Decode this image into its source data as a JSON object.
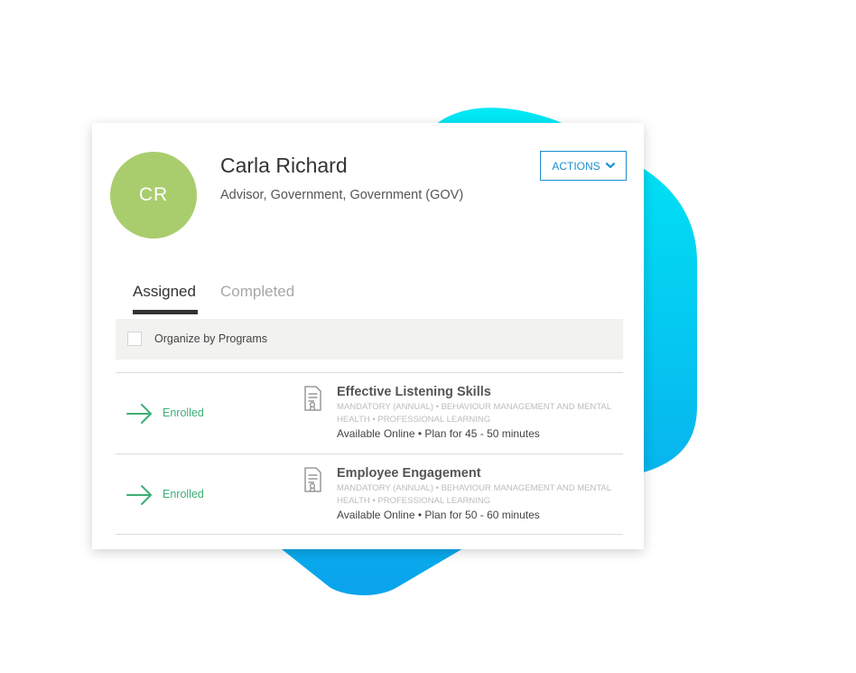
{
  "profile": {
    "initials": "CR",
    "name": "Carla Richard",
    "role": "Advisor, Government, Government (GOV)",
    "avatar_color": "#a9cd6d"
  },
  "actions": {
    "label": "ACTIONS",
    "icon": "chevron-down-icon"
  },
  "tabs": [
    {
      "label": "Assigned",
      "active": true
    },
    {
      "label": "Completed",
      "active": false
    }
  ],
  "filter": {
    "label": "Organize by Programs",
    "checked": false
  },
  "courses": [
    {
      "status": "Enrolled",
      "title": "Effective Listening Skills",
      "tags": "MANDATORY (ANNUAL) • BEHAVIOUR MANAGEMENT AND MENTAL HEALTH • PROFESSIONAL LEARNING",
      "meta": "Available Online • Plan for 45 - 50 minutes"
    },
    {
      "status": "Enrolled",
      "title": "Employee Engagement",
      "tags": "MANDATORY (ANNUAL) • BEHAVIOUR MANAGEMENT AND MENTAL HEALTH • PROFESSIONAL LEARNING",
      "meta": "Available Online • Plan for 50 - 60 minutes"
    }
  ],
  "colors": {
    "accent": "#1b8fcf",
    "enrolled": "#3daf76",
    "blob_top": "#00e5f5",
    "blob_bottom": "#0fa6ec"
  }
}
